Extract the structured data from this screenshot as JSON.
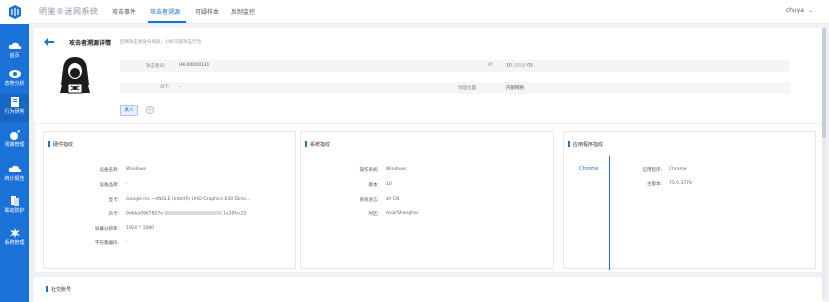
{
  "app": {
    "brand": "明鉴®迷网系统"
  },
  "sidebar": {
    "items": [
      {
        "label": "首页",
        "icon": "cloud-icon"
      },
      {
        "label": "态势分析",
        "icon": "eye-icon"
      },
      {
        "label": "行为研判",
        "icon": "book-icon"
      },
      {
        "label": "诱捕管理",
        "icon": "target-icon"
      },
      {
        "label": "统计报告",
        "icon": "cloud-report-icon"
      },
      {
        "label": "联动防护",
        "icon": "shield-icon"
      },
      {
        "label": "系统管理",
        "icon": "gear-icon"
      }
    ]
  },
  "topbar": {
    "tabs": [
      {
        "label": "攻击事件"
      },
      {
        "label": "攻击者溯源"
      },
      {
        "label": "可疑样本"
      },
      {
        "label": "反制监控"
      }
    ],
    "user": "chuya"
  },
  "detail": {
    "title": "攻击者溯源详情",
    "subtitle": "回溯攻击者身份线索，分析可疑攻击行为",
    "fields": {
      "attacker_id": {
        "label": "攻击者ID:",
        "value": "HK-00000131"
      },
      "ip": {
        "label": "IP:",
        "value_prefix": "10.",
        "value_suffix": "05"
      },
      "xff": {
        "label": "XFF:",
        "value": "-"
      },
      "location": {
        "label": "地理位置:",
        "value": "内部网络"
      }
    },
    "tag": "真人",
    "add_label": "+"
  },
  "hardware": {
    "title": "硬件指纹",
    "rows": [
      {
        "key": "设备名称:",
        "value": "Windows"
      },
      {
        "key": "设备品牌:",
        "value": "-"
      },
      {
        "key": "显卡:",
        "value": "Google Inc.~ANGLE (Intel(R) UHD Graphics 630 Direc..."
      },
      {
        "key": "声卡:",
        "value_prefix": "9d6ba0967827e",
        "value_suffix": "1a30fcc25"
      },
      {
        "key": "屏幕分辨率:",
        "value": "1920 * 1080"
      },
      {
        "key": "字符集编码:",
        "value": "-"
      }
    ]
  },
  "system": {
    "title": "系统指纹",
    "rows": [
      {
        "key": "操作系统:",
        "value": "Windows"
      },
      {
        "key": "版本:",
        "value": "10"
      },
      {
        "key": "系统语言:",
        "value": "zh-CN"
      },
      {
        "key": "时区:",
        "value": "Asia/Shanghai"
      }
    ]
  },
  "application": {
    "title": "应用程序指纹",
    "tab": "Chrome",
    "rows": [
      {
        "key": "应用程序:",
        "value": "Chrome"
      },
      {
        "key": "主版本:",
        "value": "75.0.3770"
      }
    ]
  },
  "social": {
    "title": "社交账号"
  },
  "colors": {
    "accent": "#1a72d8",
    "sidebar": "#1a72d8"
  }
}
